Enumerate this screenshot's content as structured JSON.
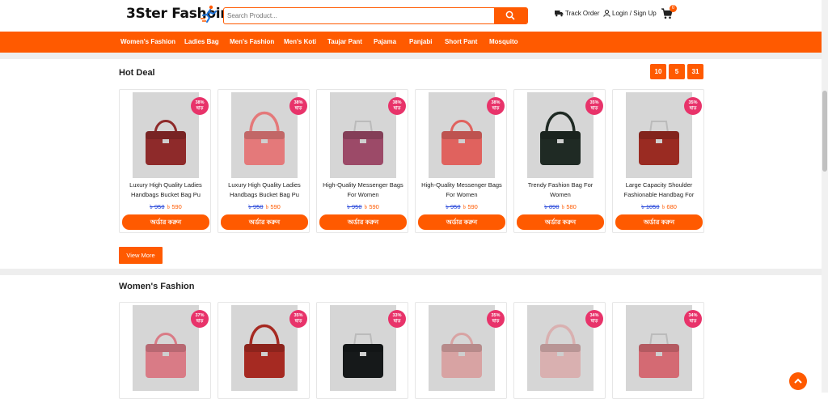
{
  "header": {
    "logo_text": "3Ster Fashoin",
    "search_placeholder": "Search Product...",
    "track_order": "Track Order",
    "login_signup": "Login / Sign Up",
    "cart_count": "0"
  },
  "nav": {
    "items": [
      "Women's Fashion",
      "Ladies Bag",
      "Men's Fashion",
      "Men's Koti",
      "Taujar Pant",
      "Pajama",
      "Panjabi",
      "Short Pant",
      "Mosquito"
    ]
  },
  "hot_deal": {
    "title": "Hot Deal",
    "timer": [
      "10",
      "5",
      "31"
    ],
    "view_more": "View More",
    "products": [
      {
        "name": "Luxury High Quality Ladies Handbags Bucket Bag Pu",
        "badge_pct": "38%",
        "badge_word": "ছাড়",
        "old_price": "৳ 950",
        "new_price": "৳ 590",
        "order": "অর্ডার করুন",
        "bag_color": "#8e2a2a"
      },
      {
        "name": "Luxury High Quality Ladies Handbags Bucket Bag Pu",
        "badge_pct": "38%",
        "badge_word": "ছাড়",
        "old_price": "৳ 950",
        "new_price": "৳ 590",
        "order": "অর্ডার করুন",
        "bag_color": "#e4797a"
      },
      {
        "name": "High-Quality Messenger Bags For Women",
        "badge_pct": "38%",
        "badge_word": "ছাড়",
        "old_price": "৳ 950",
        "new_price": "৳ 590",
        "order": "অর্ডার করুন",
        "bag_color": "#9c4a68"
      },
      {
        "name": "High-Quality Messenger Bags For Women",
        "badge_pct": "38%",
        "badge_word": "ছাড়",
        "old_price": "৳ 950",
        "new_price": "৳ 590",
        "order": "অর্ডার করুন",
        "bag_color": "#e0625e"
      },
      {
        "name": "Trendy Fashion Bag For Women",
        "badge_pct": "35%",
        "badge_word": "ছাড়",
        "old_price": "৳ 890",
        "new_price": "৳ 580",
        "order": "অর্ডার করুন",
        "bag_color": "#1f2a24"
      },
      {
        "name": "Large Capacity Shoulder Fashionable Handbag For",
        "badge_pct": "35%",
        "badge_word": "ছাড়",
        "old_price": "৳ 1050",
        "new_price": "৳ 680",
        "order": "অর্ডার করুন",
        "bag_color": "#9a2b22"
      }
    ]
  },
  "womens_fashion": {
    "title": "Women's Fashion",
    "products": [
      {
        "badge_pct": "37%",
        "badge_word": "ছাড়",
        "bag_color": "#d97b86"
      },
      {
        "badge_pct": "35%",
        "badge_word": "ছাড়",
        "bag_color": "#a62a22"
      },
      {
        "badge_pct": "33%",
        "badge_word": "ছাড়",
        "bag_color": "#16191a"
      },
      {
        "badge_pct": "35%",
        "badge_word": "ছাড়",
        "bag_color": "#d8a3a3"
      },
      {
        "badge_pct": "34%",
        "badge_word": "ছাড়",
        "bag_color": "#d9b0b0"
      },
      {
        "badge_pct": "34%",
        "badge_word": "ছাড়",
        "bag_color": "#d46a73"
      }
    ]
  },
  "colors": {
    "accent": "#ff5a00",
    "badge": "#e8336a",
    "old_price": "#2646d9"
  },
  "icons": [
    "runner-logo-icon",
    "search-icon",
    "truck-icon",
    "user-icon",
    "cart-icon",
    "chevron-up-icon"
  ]
}
